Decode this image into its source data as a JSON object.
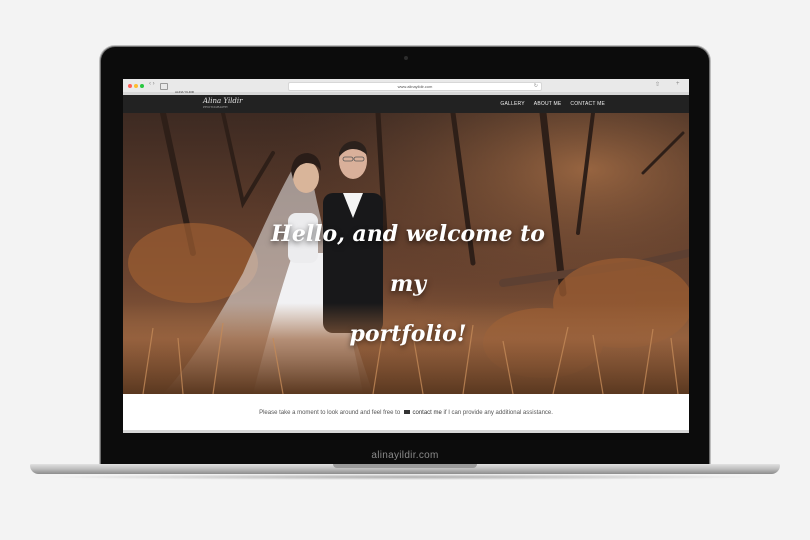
{
  "browser": {
    "url": "www.alinayildir.com",
    "tab_label": "ALINA YILDIR"
  },
  "site": {
    "logo_text": "Alina Yildir",
    "logo_subtitle": "PHOTOGRAPHY",
    "nav": [
      "GALLERY",
      "ABOUT ME",
      "CONTACT ME"
    ]
  },
  "hero": {
    "title_line1": "Hello, and welcome to my",
    "title_line2": "portfolio!"
  },
  "info": {
    "before": "Please take a moment to look around and feel free to",
    "contact_link": "contact me",
    "after": "if I can provide any additional assistance."
  },
  "device": {
    "chin_label": "alinayildir.com"
  },
  "colors": {
    "nav_bg": "#222222",
    "page_bg": "#f3f3f3"
  }
}
